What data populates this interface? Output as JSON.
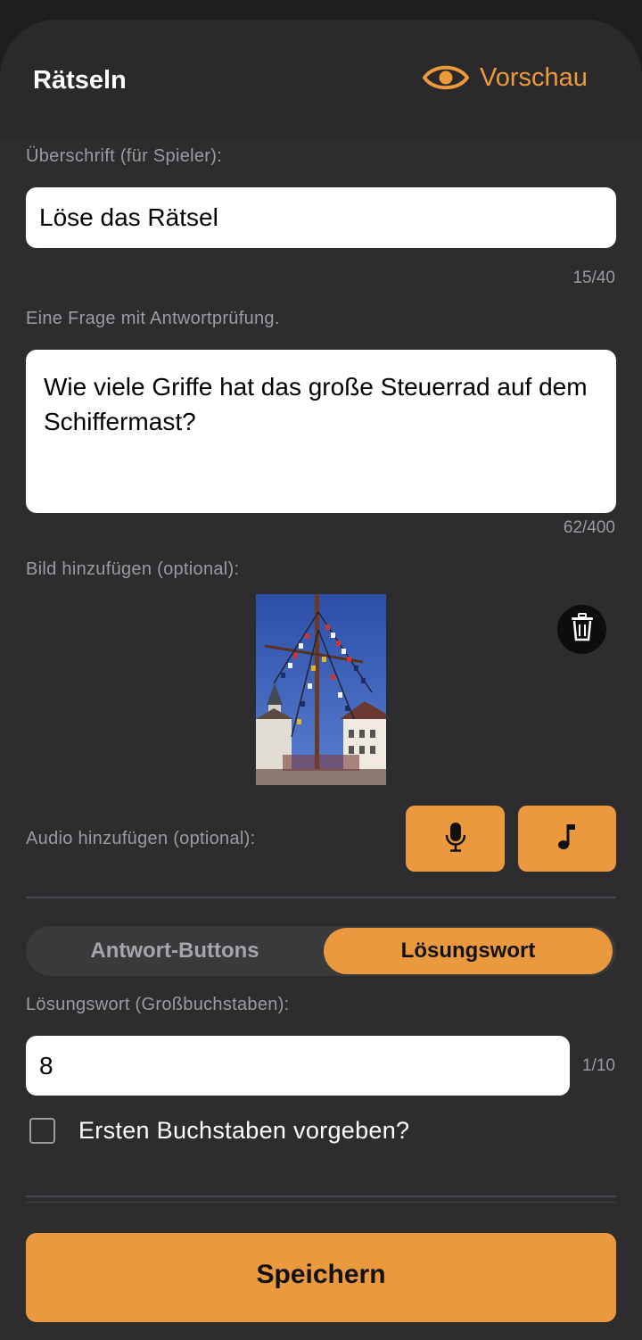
{
  "header": {
    "title": "Rätseln",
    "preview_label": "Vorschau"
  },
  "heading_section": {
    "label": "Überschrift (für Spieler):",
    "value": "Löse das Rätsel",
    "counter": "15/40"
  },
  "question_section": {
    "label": "Eine Frage mit Antwortprüfung.",
    "value": "Wie viele Griffe hat das große Steuerrad auf dem Schiffermast?",
    "counter": "62/400"
  },
  "image_section": {
    "label": "Bild hinzufügen (optional):",
    "delete_icon": "trash-icon"
  },
  "audio_section": {
    "label": "Audio hinzufügen (optional):",
    "record_icon": "microphone-icon",
    "music_icon": "music-note-icon"
  },
  "answer_mode": {
    "options": [
      "Antwort-Buttons",
      "Lösungswort"
    ],
    "selected": "Lösungswort"
  },
  "solution_section": {
    "label": "Lösungswort (Großbuchstaben):",
    "value": "8",
    "counter": "1/10",
    "checkbox_label": "Ersten Buchstaben vorgeben?",
    "checkbox_checked": false
  },
  "footer": {
    "save_label": "Speichern"
  },
  "colors": {
    "accent": "#eb993e",
    "background": "#2d2d2f",
    "muted_text": "#9b9ba0"
  }
}
